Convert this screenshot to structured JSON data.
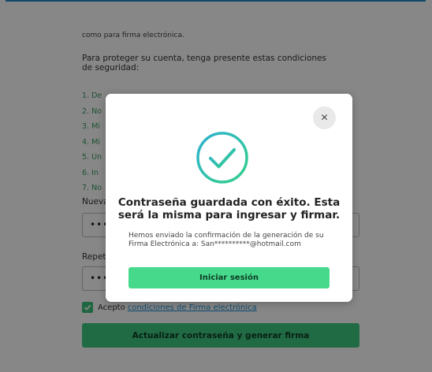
{
  "page": {
    "cut_text": "como para firma electrónica.",
    "intro": "Para proteger su cuenta, tenga presente estas condiciones de seguridad:",
    "conditions": [
      "1. De",
      "2. No",
      "3. Mi",
      "4. Mi",
      "5. Un",
      "6. In",
      "7. No"
    ],
    "new_password_label": "Nueva contraseña",
    "new_password_value": "••••••••",
    "repeat_password_label": "Repetir contraseña",
    "repeat_password_value": "••••••••",
    "accept_prefix": "Acepto",
    "accept_link": "condiciones de Firma electrónica",
    "submit_label": "Actualizar contraseña y generar firma"
  },
  "modal": {
    "close_glyph": "×",
    "title": "Contraseña guardada con éxito. Esta será la misma para ingresar y firmar.",
    "body": "Hemos enviado la confirmación de la generación de su Firma Electrónica a: San**********@hotmail.com",
    "button_label": "Iniciar sesión"
  },
  "colors": {
    "accent_green": "#3fca80",
    "link_blue": "#1d8fd2",
    "check_teal": "#2ec4b0"
  }
}
